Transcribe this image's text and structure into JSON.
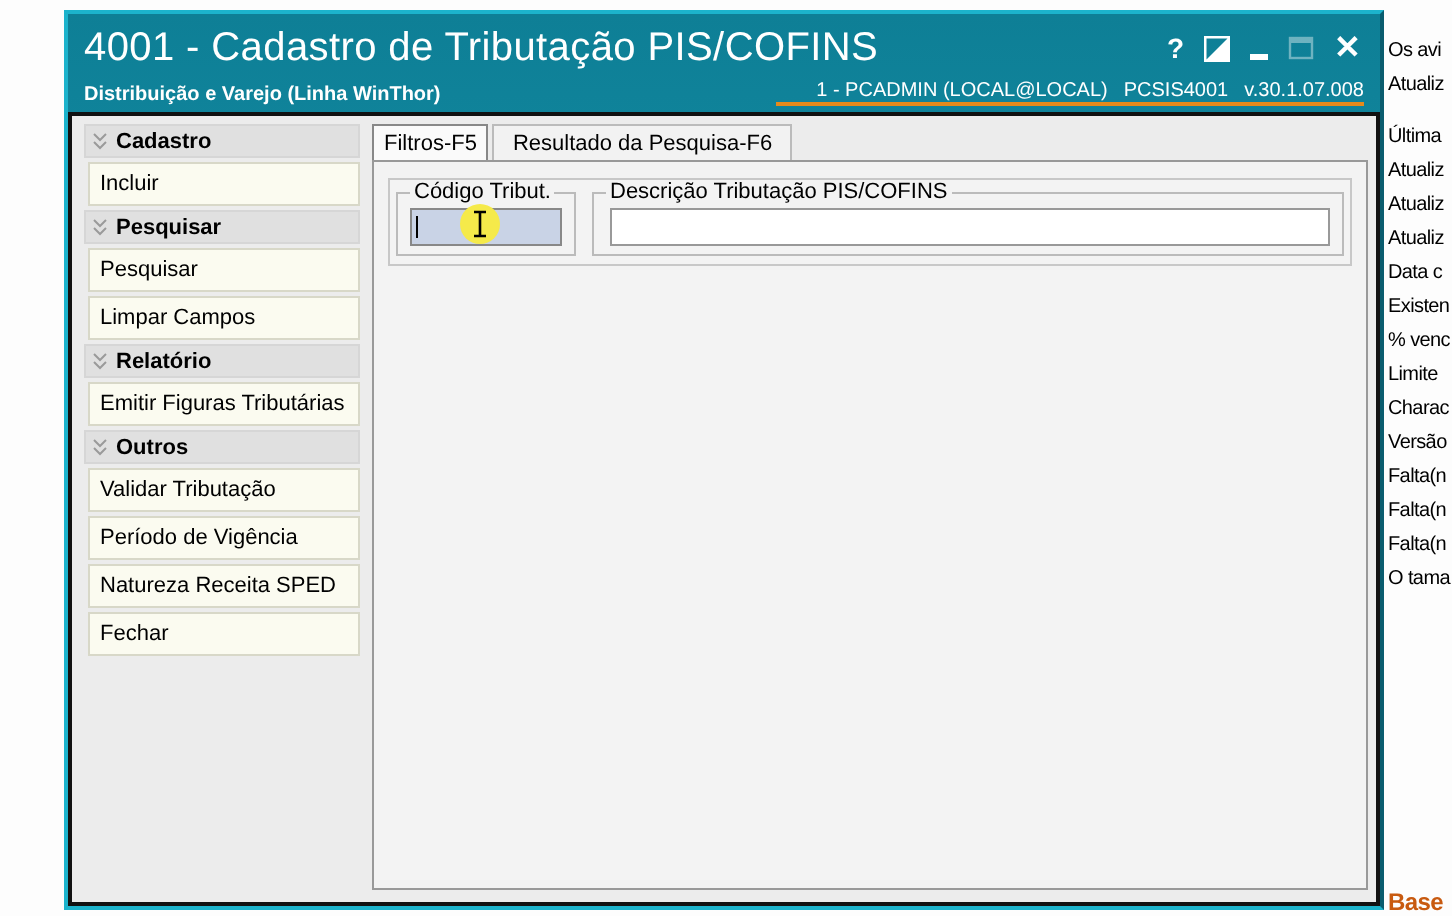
{
  "window": {
    "title": "4001 - Cadastro de Tributação PIS/COFINS",
    "subtitle": "Distribuição e Varejo (Linha WinThor)",
    "session": "1 - PCADMIN (LOCAL@LOCAL)",
    "program": "PCSIS4001",
    "version": "v.30.1.07.008",
    "controls": [
      {
        "kind": "help",
        "label": "?"
      },
      {
        "kind": "theme"
      },
      {
        "kind": "minimize",
        "disabled": false
      },
      {
        "kind": "maximize",
        "disabled": true
      },
      {
        "kind": "close",
        "label": "✕"
      }
    ]
  },
  "sidebar": {
    "groups": [
      {
        "title": "Cadastro",
        "items": [
          "Incluir"
        ]
      },
      {
        "title": "Pesquisar",
        "items": [
          "Pesquisar",
          "Limpar Campos"
        ]
      },
      {
        "title": "Relatório",
        "items": [
          "Emitir Figuras Tributárias"
        ]
      },
      {
        "title": "Outros",
        "items": [
          "Validar Tributação",
          "Período de Vigência",
          "Natureza Receita SPED",
          "Fechar"
        ]
      }
    ]
  },
  "tabs": [
    {
      "label": "Filtros-F5",
      "selected": true
    },
    {
      "label": "Resultado da Pesquisa-F6",
      "selected": false
    }
  ],
  "filters": [
    {
      "label": "Código Tribut.",
      "focused": true,
      "kind": "short"
    },
    {
      "label": "Descrição Tributação PIS/COFINS",
      "focused": false,
      "kind": "wide"
    }
  ],
  "background_page": {
    "lines": [
      "Os avi",
      "Atualiz",
      "Última",
      "Atualiz",
      "Atualiz",
      "Atualiz",
      "Data c",
      "Existen",
      "% venc",
      "Limite",
      "Charac",
      "Versão",
      "Falta(n",
      "Falta(n",
      "Falta(n",
      "O tama"
    ],
    "footer": "Base"
  }
}
